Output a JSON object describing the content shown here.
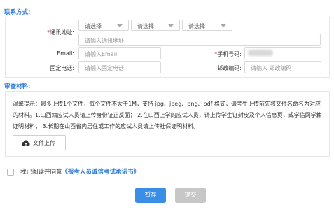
{
  "contact": {
    "title": "联系方式:",
    "address_label_req": "*",
    "address_label": "通讯地址:",
    "selects": [
      "请选择",
      "请选择",
      "请选择"
    ],
    "address_placeholder": "请输入通讯地址",
    "email_label": "Email:",
    "email_placeholder": "请输入Email",
    "mobile_label_req": "*",
    "mobile_label": "手机号码:",
    "phone_label": "固定电话:",
    "phone_placeholder": "请输入固定电话",
    "postcode_label": "邮政编码:",
    "postcode_placeholder": "请输入 邮政编码"
  },
  "materials": {
    "title": "审查材料:",
    "hint": "温馨提示：最多上传1个文件，每个文件不大于1M，支持 jpg、jpeg、png、pdf 格式，请考生上传前先将文件名命名为对应的材料。1.山西籍应试人员请上传身份证正反面； 2.在山西上学的应试人员，请上传学生证封皮及个人信息页，或学信网学籍证明材料； 3.长期在山西省内居住或工作的应试人员请上传社保证明材料。",
    "upload_label": "文件上传",
    "upload_icon": "cloud-upload-icon"
  },
  "agreement": {
    "prefix": "我已阅读并同意",
    "link": "《报考人员诚信考试承诺书》"
  },
  "actions": {
    "save": "暂存",
    "submit": "提交"
  },
  "colors": {
    "accent": "#3a8ee6",
    "section_title": "#2f7bd8",
    "required": "#e03a3a",
    "disabled": "#c7c7c7"
  }
}
